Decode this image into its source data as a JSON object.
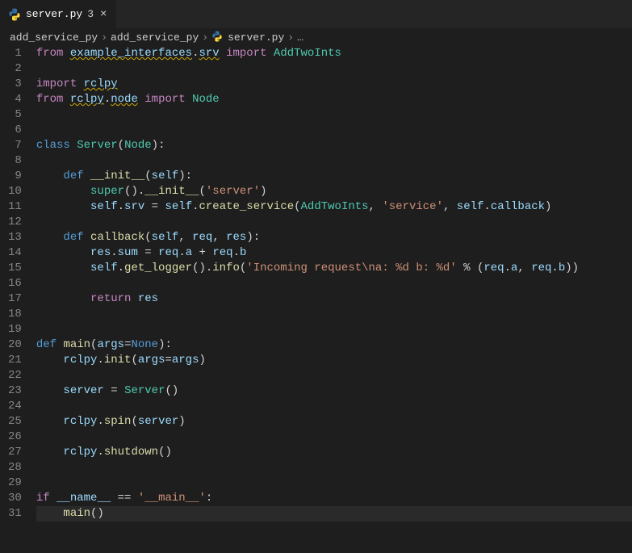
{
  "tab": {
    "filename": "server.py",
    "dirty_indicator": "3",
    "close_glyph": "×"
  },
  "breadcrumbs": {
    "sep": "›",
    "items": [
      "add_service_py",
      "add_service_py",
      "server.py",
      "…"
    ]
  },
  "gutter": {
    "start": 1,
    "end": 31
  },
  "code_lines": [
    [
      [
        "kw",
        "from"
      ],
      [
        "op",
        " "
      ],
      [
        "var squiggle",
        "example_interfaces"
      ],
      [
        "pun",
        "."
      ],
      [
        "var squiggle",
        "srv"
      ],
      [
        "op",
        " "
      ],
      [
        "kw",
        "import"
      ],
      [
        "op",
        " "
      ],
      [
        "type",
        "AddTwoInts"
      ]
    ],
    [],
    [
      [
        "kw",
        "import"
      ],
      [
        "op",
        " "
      ],
      [
        "var squiggle",
        "rclpy"
      ]
    ],
    [
      [
        "kw",
        "from"
      ],
      [
        "op",
        " "
      ],
      [
        "var squiggle",
        "rclpy"
      ],
      [
        "pun",
        "."
      ],
      [
        "var squiggle",
        "node"
      ],
      [
        "op",
        " "
      ],
      [
        "kw",
        "import"
      ],
      [
        "op",
        " "
      ],
      [
        "type",
        "Node"
      ]
    ],
    [],
    [],
    [
      [
        "cls",
        "class"
      ],
      [
        "op",
        " "
      ],
      [
        "type",
        "Server"
      ],
      [
        "pun",
        "("
      ],
      [
        "type",
        "Node"
      ],
      [
        "pun",
        "):"
      ]
    ],
    [],
    [
      [
        "op",
        "    "
      ],
      [
        "cls",
        "def"
      ],
      [
        "op",
        " "
      ],
      [
        "fn",
        "__init__"
      ],
      [
        "pun",
        "("
      ],
      [
        "var",
        "self"
      ],
      [
        "pun",
        "):"
      ]
    ],
    [
      [
        "op",
        "        "
      ],
      [
        "builtin",
        "super"
      ],
      [
        "pun",
        "()."
      ],
      [
        "fn",
        "__init__"
      ],
      [
        "pun",
        "("
      ],
      [
        "str",
        "'server'"
      ],
      [
        "pun",
        ")"
      ]
    ],
    [
      [
        "op",
        "        "
      ],
      [
        "var",
        "self"
      ],
      [
        "pun",
        "."
      ],
      [
        "var",
        "srv"
      ],
      [
        "op",
        " = "
      ],
      [
        "var",
        "self"
      ],
      [
        "pun",
        "."
      ],
      [
        "fn",
        "create_service"
      ],
      [
        "pun",
        "("
      ],
      [
        "type",
        "AddTwoInts"
      ],
      [
        "pun",
        ", "
      ],
      [
        "str",
        "'service'"
      ],
      [
        "pun",
        ", "
      ],
      [
        "var",
        "self"
      ],
      [
        "pun",
        "."
      ],
      [
        "var",
        "callback"
      ],
      [
        "pun",
        ")"
      ]
    ],
    [],
    [
      [
        "op",
        "    "
      ],
      [
        "cls",
        "def"
      ],
      [
        "op",
        " "
      ],
      [
        "fn",
        "callback"
      ],
      [
        "pun",
        "("
      ],
      [
        "var",
        "self"
      ],
      [
        "pun",
        ", "
      ],
      [
        "var",
        "req"
      ],
      [
        "pun",
        ", "
      ],
      [
        "var",
        "res"
      ],
      [
        "pun",
        "):"
      ]
    ],
    [
      [
        "op",
        "        "
      ],
      [
        "var",
        "res"
      ],
      [
        "pun",
        "."
      ],
      [
        "var",
        "sum"
      ],
      [
        "op",
        " = "
      ],
      [
        "var",
        "req"
      ],
      [
        "pun",
        "."
      ],
      [
        "var",
        "a"
      ],
      [
        "op",
        " + "
      ],
      [
        "var",
        "req"
      ],
      [
        "pun",
        "."
      ],
      [
        "var",
        "b"
      ]
    ],
    [
      [
        "op",
        "        "
      ],
      [
        "var",
        "self"
      ],
      [
        "pun",
        "."
      ],
      [
        "fn",
        "get_logger"
      ],
      [
        "pun",
        "()."
      ],
      [
        "fn",
        "info"
      ],
      [
        "pun",
        "("
      ],
      [
        "str",
        "'Incoming request\\na: %d b: %d'"
      ],
      [
        "op",
        " % ("
      ],
      [
        "var",
        "req"
      ],
      [
        "pun",
        "."
      ],
      [
        "var",
        "a"
      ],
      [
        "pun",
        ", "
      ],
      [
        "var",
        "req"
      ],
      [
        "pun",
        "."
      ],
      [
        "var",
        "b"
      ],
      [
        "pun",
        "))"
      ]
    ],
    [],
    [
      [
        "op",
        "        "
      ],
      [
        "kw",
        "return"
      ],
      [
        "op",
        " "
      ],
      [
        "var",
        "res"
      ]
    ],
    [],
    [],
    [
      [
        "cls",
        "def"
      ],
      [
        "op",
        " "
      ],
      [
        "fn",
        "main"
      ],
      [
        "pun",
        "("
      ],
      [
        "var",
        "args"
      ],
      [
        "op",
        "="
      ],
      [
        "cls",
        "None"
      ],
      [
        "pun",
        "):"
      ]
    ],
    [
      [
        "op",
        "    "
      ],
      [
        "var",
        "rclpy"
      ],
      [
        "pun",
        "."
      ],
      [
        "fn",
        "init"
      ],
      [
        "pun",
        "("
      ],
      [
        "var",
        "args"
      ],
      [
        "op",
        "="
      ],
      [
        "var",
        "args"
      ],
      [
        "pun",
        ")"
      ]
    ],
    [],
    [
      [
        "op",
        "    "
      ],
      [
        "var",
        "server"
      ],
      [
        "op",
        " = "
      ],
      [
        "type",
        "Server"
      ],
      [
        "pun",
        "()"
      ]
    ],
    [],
    [
      [
        "op",
        "    "
      ],
      [
        "var",
        "rclpy"
      ],
      [
        "pun",
        "."
      ],
      [
        "fn",
        "spin"
      ],
      [
        "pun",
        "("
      ],
      [
        "var",
        "server"
      ],
      [
        "pun",
        ")"
      ]
    ],
    [],
    [
      [
        "op",
        "    "
      ],
      [
        "var",
        "rclpy"
      ],
      [
        "pun",
        "."
      ],
      [
        "fn",
        "shutdown"
      ],
      [
        "pun",
        "()"
      ]
    ],
    [],
    [],
    [
      [
        "kw",
        "if"
      ],
      [
        "op",
        " "
      ],
      [
        "var",
        "__name__"
      ],
      [
        "op",
        " == "
      ],
      [
        "str",
        "'__main__'"
      ],
      [
        "pun",
        ":"
      ]
    ],
    [
      [
        "op",
        "    "
      ],
      [
        "fn",
        "main"
      ],
      [
        "pun",
        "()"
      ]
    ]
  ],
  "highlight_line": 31,
  "icons": {
    "python_color_a": "#3571a3",
    "python_color_b": "#ffd43b"
  }
}
